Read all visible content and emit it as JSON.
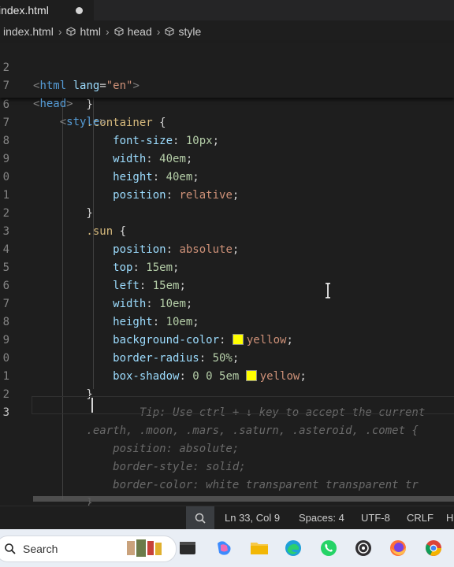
{
  "tab": {
    "filename": "index.html"
  },
  "breadcrumb": {
    "file": "index.html",
    "items": [
      "html",
      "head",
      "style"
    ]
  },
  "sticky_lines": [
    {
      "num": "2",
      "tokens": [
        [
          "t-punct",
          "<"
        ],
        [
          "t-tag",
          "html"
        ],
        [
          "t-attr",
          " lang"
        ],
        [
          "t-brace",
          "="
        ],
        [
          "t-str",
          "\"en\""
        ],
        [
          "t-punct",
          ">"
        ]
      ]
    },
    {
      "num": "7",
      "tokens": [
        [
          "t-punct",
          "<"
        ],
        [
          "t-tag",
          "head"
        ],
        [
          "t-punct",
          ">"
        ]
      ]
    },
    {
      "num": "",
      "tokens": [
        [
          "t-punct",
          "    <"
        ],
        [
          "t-tag",
          "style"
        ],
        [
          "t-punct",
          ">"
        ]
      ]
    }
  ],
  "code_lines": [
    {
      "num": "6",
      "text": "        }"
    },
    {
      "num": "7",
      "tokens": [
        [
          "t-sel",
          "        .container"
        ],
        [
          "t-brace",
          " {"
        ]
      ]
    },
    {
      "num": "8",
      "tokens": [
        [
          "t-prop",
          "            font-size"
        ],
        [
          "t-brace",
          ": "
        ],
        [
          "t-num",
          "10px"
        ],
        [
          "t-brace",
          ";"
        ]
      ]
    },
    {
      "num": "9",
      "tokens": [
        [
          "t-prop",
          "            width"
        ],
        [
          "t-brace",
          ": "
        ],
        [
          "t-num",
          "40em"
        ],
        [
          "t-brace",
          ";"
        ]
      ]
    },
    {
      "num": "0",
      "tokens": [
        [
          "t-prop",
          "            height"
        ],
        [
          "t-brace",
          ": "
        ],
        [
          "t-num",
          "40em"
        ],
        [
          "t-brace",
          ";"
        ]
      ]
    },
    {
      "num": "1",
      "tokens": [
        [
          "t-prop",
          "            position"
        ],
        [
          "t-brace",
          ": "
        ],
        [
          "t-val",
          "relative"
        ],
        [
          "t-brace",
          ";"
        ]
      ]
    },
    {
      "num": "2",
      "tokens": [
        [
          "t-brace",
          "        }"
        ]
      ]
    },
    {
      "num": "3",
      "tokens": [
        [
          "t-sel",
          "        .sun"
        ],
        [
          "t-brace",
          " {"
        ]
      ]
    },
    {
      "num": "4",
      "tokens": [
        [
          "t-prop",
          "            position"
        ],
        [
          "t-brace",
          ": "
        ],
        [
          "t-val",
          "absolute"
        ],
        [
          "t-brace",
          ";"
        ]
      ]
    },
    {
      "num": "5",
      "tokens": [
        [
          "t-prop",
          "            top"
        ],
        [
          "t-brace",
          ": "
        ],
        [
          "t-num",
          "15em"
        ],
        [
          "t-brace",
          ";"
        ]
      ]
    },
    {
      "num": "6",
      "tokens": [
        [
          "t-prop",
          "            left"
        ],
        [
          "t-brace",
          ": "
        ],
        [
          "t-num",
          "15em"
        ],
        [
          "t-brace",
          ";"
        ]
      ]
    },
    {
      "num": "7",
      "tokens": [
        [
          "t-prop",
          "            width"
        ],
        [
          "t-brace",
          ": "
        ],
        [
          "t-num",
          "10em"
        ],
        [
          "t-brace",
          ";"
        ]
      ]
    },
    {
      "num": "8",
      "tokens": [
        [
          "t-prop",
          "            height"
        ],
        [
          "t-brace",
          ": "
        ],
        [
          "t-num",
          "10em"
        ],
        [
          "t-brace",
          ";"
        ]
      ]
    },
    {
      "num": "9",
      "tokens": [
        [
          "t-prop",
          "            background-color"
        ],
        [
          "t-brace",
          ": "
        ],
        [
          "swatch",
          ""
        ],
        [
          "t-val",
          "yellow"
        ],
        [
          "t-brace",
          ";"
        ]
      ]
    },
    {
      "num": "0",
      "tokens": [
        [
          "t-prop",
          "            border-radius"
        ],
        [
          "t-brace",
          ": "
        ],
        [
          "t-num",
          "50%"
        ],
        [
          "t-brace",
          ";"
        ]
      ]
    },
    {
      "num": "1",
      "tokens": [
        [
          "t-prop",
          "            box-shadow"
        ],
        [
          "t-brace",
          ": "
        ],
        [
          "t-num",
          "0 0 5em "
        ],
        [
          "swatch",
          ""
        ],
        [
          "t-val",
          "yellow"
        ],
        [
          "t-brace",
          ";"
        ]
      ]
    },
    {
      "num": "2",
      "tokens": [
        [
          "t-brace",
          "        }"
        ]
      ]
    },
    {
      "num": "3",
      "current": true,
      "tokens": [
        [
          "ghost",
          "                Tip: Use ctrl + ↓ key to accept the current"
        ]
      ]
    },
    {
      "num": "",
      "tokens": [
        [
          "ghost",
          "        .earth, .moon, .mars, .saturn, .asteroid, .comet {"
        ]
      ]
    },
    {
      "num": "",
      "tokens": [
        [
          "ghost",
          "            position: absolute;"
        ]
      ]
    },
    {
      "num": "",
      "tokens": [
        [
          "ghost",
          "            border-style: solid;"
        ]
      ]
    },
    {
      "num": "",
      "tokens": [
        [
          "ghost",
          "            border-color: white transparent transparent tr"
        ]
      ]
    },
    {
      "num": "",
      "tokens": [
        [
          "ghost",
          "        }"
        ]
      ]
    }
  ],
  "status": {
    "position": "Ln 33, Col 9",
    "spaces": "Spaces: 4",
    "encoding": "UTF-8",
    "eol": "CRLF",
    "lang": "H"
  },
  "taskbar": {
    "search_label": "Search",
    "apps": [
      "terminal-icon",
      "copilot-icon",
      "file-explorer-icon",
      "edge-icon",
      "whatsapp-icon",
      "obs-icon",
      "firefox-icon",
      "chrome-icon"
    ]
  }
}
